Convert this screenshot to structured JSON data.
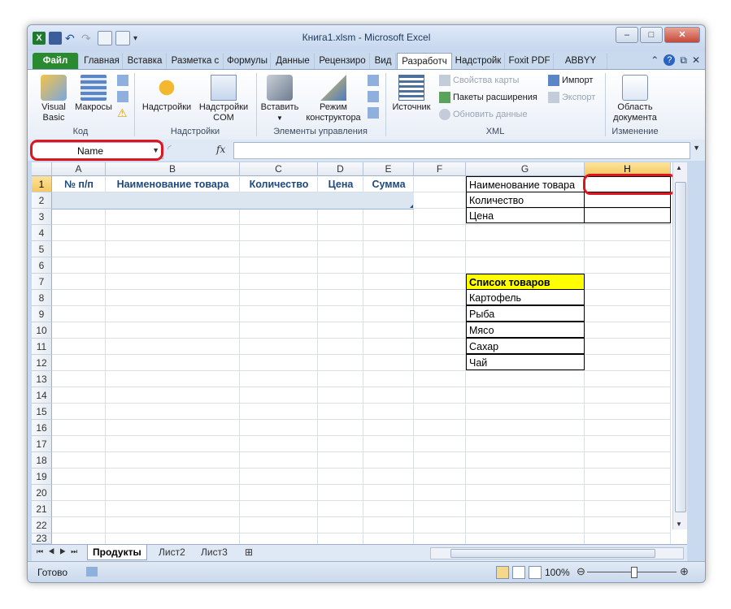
{
  "window": {
    "title": "Книга1.xlsm - Microsoft Excel"
  },
  "tabs": [
    "Файл",
    "Главная",
    "Вставка",
    "Разметка с",
    "Формулы",
    "Данные",
    "Рецензиро",
    "Вид",
    "Разработч",
    "Надстройк",
    "Foxit PDF",
    "ABBYY PDF"
  ],
  "ribbon": {
    "code": {
      "visual_basic": "Visual Basic",
      "macros": "Макросы",
      "label": "Код"
    },
    "addins": {
      "addins": "Надстройки",
      "com_addins": "Надстройки COM",
      "label": "Надстройки"
    },
    "controls": {
      "insert": "Вставить",
      "design_mode": "Режим конструктора",
      "label": "Элементы управления"
    },
    "xml": {
      "source": "Источник",
      "map_props": "Свойства карты",
      "expansion_packs": "Пакеты расширения",
      "refresh": "Обновить данные",
      "import": "Импорт",
      "export": "Экспорт",
      "label": "XML"
    },
    "modify": {
      "doc_panel": "Область документа",
      "label": "Изменение"
    }
  },
  "formula_bar": {
    "name_box": "Name",
    "fx": "fx",
    "value": ""
  },
  "columns": [
    "A",
    "B",
    "C",
    "D",
    "E",
    "F",
    "G",
    "H"
  ],
  "rows": [
    "1",
    "2",
    "3",
    "4",
    "5",
    "6",
    "7",
    "8",
    "9",
    "10",
    "11",
    "12",
    "13",
    "14",
    "15",
    "16",
    "17",
    "18",
    "19",
    "20",
    "21",
    "22",
    "23"
  ],
  "table_headers": {
    "a1": "№ п/п",
    "b1": "Наименование товара",
    "c1": "Количество",
    "d1": "Цена",
    "e1": "Сумма"
  },
  "form": {
    "g1": "Наименование товара",
    "g2": "Количество",
    "g3": "Цена"
  },
  "products": {
    "title": "Список товаров",
    "items": [
      "Картофель",
      "Рыба",
      "Мясо",
      "Сахар",
      "Чай"
    ],
    "title_bg": "#ffff00"
  },
  "sheets": [
    "Продукты",
    "Лист2",
    "Лист3"
  ],
  "status": {
    "ready": "Готово",
    "zoom": "100%"
  },
  "colors": {
    "accent_red": "#e0141e",
    "file_tab": "#2a8a2f",
    "header_text": "#1f497d"
  }
}
